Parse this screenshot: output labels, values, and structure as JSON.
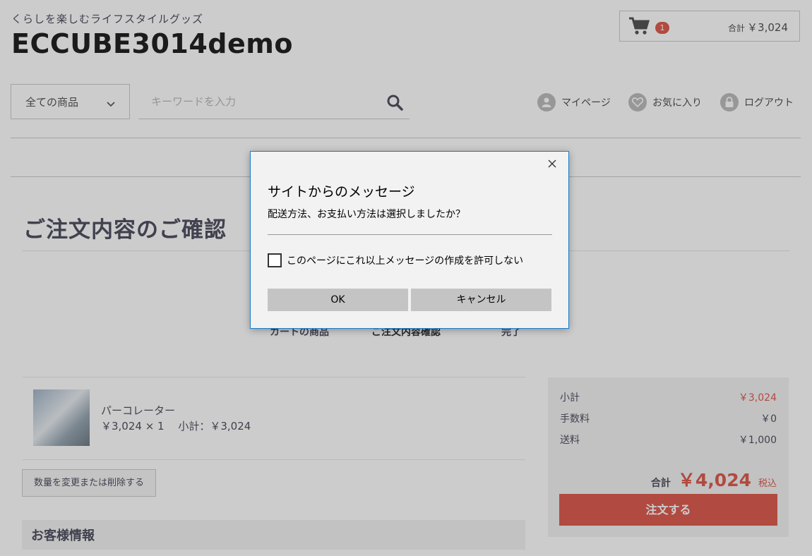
{
  "header": {
    "tagline": "くらしを楽しむライフスタイルグッズ",
    "logo": "ECCUBE3014demo",
    "cart": {
      "count": "1",
      "total_label": "合計",
      "total": "￥3,024"
    }
  },
  "search": {
    "category": "全ての商品",
    "placeholder": "キーワードを入力"
  },
  "nav": {
    "mypage": "マイページ",
    "favorites": "お気に入り",
    "logout": "ログアウト"
  },
  "main": {
    "title": "ご注文内容のご確認",
    "steps": [
      "カートの商品",
      "ご注文内容確認",
      "完了"
    ],
    "item": {
      "name": "パーコレーター",
      "price_line": "￥3,024 × 1　 小計：￥3,024"
    },
    "edit_button": "数量を変更または削除する",
    "customer_heading": "お客様情報"
  },
  "summary": {
    "subtotal_label": "小計",
    "subtotal": "￥3,024",
    "fee_label": "手数料",
    "fee": "￥0",
    "shipping_label": "送料",
    "shipping": "￥1,000",
    "total_label": "合計",
    "total": "￥4,024",
    "tax_note": "税込",
    "order_button": "注文する"
  },
  "dialog": {
    "title": "サイトからのメッセージ",
    "message": "配送方法、お支払い方法は選択しましたか？",
    "checkbox_label": "このページにこれ以上メッセージの作成を許可しない",
    "ok": "OK",
    "cancel": "キャンセル"
  },
  "colors": {
    "accent": "#de5d50",
    "dialog_border": "#1a7bc7",
    "dialog_button": "#c4c4c4"
  }
}
